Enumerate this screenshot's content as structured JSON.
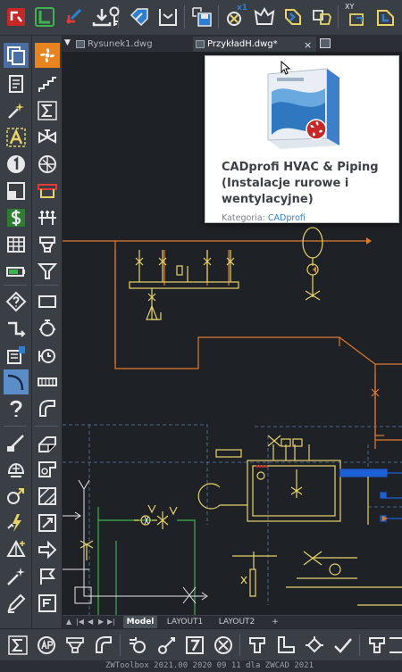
{
  "tabs": [
    {
      "label": "Rysunek1.dwg"
    },
    {
      "label": "PrzykładH.dwg*"
    }
  ],
  "tab_close_glyph": "×",
  "tooltip": {
    "title": "CADprofi HVAC & Piping (Instalacje rurowe i wentylacyjne)",
    "category_label": "Kategoria:",
    "category_link": "CADprofi"
  },
  "top_toolbar": {
    "multiplier_badge": "x1",
    "xy_badge": "XY"
  },
  "layout_tabs": [
    {
      "label": "Model"
    },
    {
      "label": "LAYOUT1"
    },
    {
      "label": "LAYOUT2"
    },
    {
      "label": "+"
    }
  ],
  "layout_nav": [
    "▲",
    "|◀",
    "◀",
    "▶",
    "▶|"
  ],
  "status_bar": {
    "text": "ZWToolbox 2021.00  2020 09 11 dla ZWCAD 2021"
  },
  "colors": {
    "toolbar_bg": "#3a3f46",
    "canvas_bg": "#1e2126",
    "pipe_orange": "#e07b2e",
    "pipe_yellow": "#e8d36a",
    "pipe_green": "#3fb34f",
    "pipe_white": "#e8e8e8",
    "accent_blue": "#1f5fd6",
    "link_blue": "#2f7fd0",
    "brand_red": "#c62828"
  },
  "icons": {
    "top": [
      "layer-red-icon",
      "layer-green-icon",
      "insert-arrow-icon",
      "download-icon",
      "key-icon",
      "tag-icon",
      "bracket-icon",
      "save-blocks-icon",
      "counter-icon",
      "polygon-icon",
      "rotate-blocks-icon",
      "replace-blocks-icon",
      "xy-blocks-icon"
    ],
    "palette_a": [
      "copy-icon",
      "paste-icon",
      "magic-wand-icon",
      "text-style-icon",
      "number-icon",
      "block-icon",
      "dollar-icon",
      "table-icon",
      "battery-icon",
      "query-icon",
      "polyline-icon",
      "attribute-icon",
      "arc-icon",
      "help-icon",
      "brush-icon",
      "wrench-icon",
      "explode-icon",
      "star-icon",
      "pyramid-icon",
      "wand-icon",
      "pen-icon"
    ],
    "palette_b": [
      "fan-icon",
      "stairs-icon",
      "sigma-icon",
      "valve-icon",
      "radiator-icon",
      "pump-icon",
      "manifold-icon",
      "filter-icon",
      "funnel-icon",
      "rectangle-icon",
      "boiler-icon",
      "meter-icon",
      "grille-icon",
      "elbow-icon",
      "duct-icon",
      "damper-icon",
      "hatch-icon",
      "fitting-icon",
      "flow-arrow-icon",
      "flag-icon",
      "symbol-icon"
    ],
    "bottom": [
      "sigma-icon",
      "ap-icon",
      "hood-icon",
      "elbow-icon",
      "gear-valve-icon",
      "thermometer-icon",
      "number-7-icon",
      "cross-circle-icon",
      "tee-icon",
      "corner-icon",
      "diamond-valve-icon",
      "check-icon",
      "tee-fitting-icon",
      "manifold-icon"
    ]
  }
}
